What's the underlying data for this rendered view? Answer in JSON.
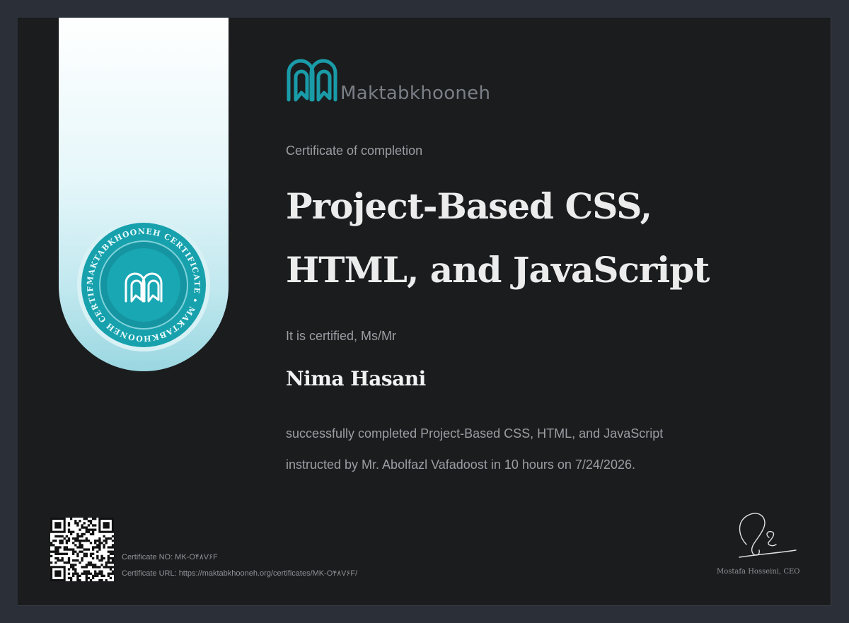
{
  "brand": {
    "name": "Maktabkhooneh",
    "teal": "#1a9ba8",
    "seal_text": "MAKTABKHOONEH CERTIFICATE • MAKTABKHOONEH CERTIFICATE •"
  },
  "certificate": {
    "subtitle": "Certificate of completion",
    "title_line1": "Project-Based CSS,",
    "title_line2": "HTML, and JavaScript",
    "certified_label": "It is certified, Ms/Mr",
    "recipient": "Nima Hasani",
    "desc_line1": "successfully completed Project-Based CSS, HTML, and JavaScript",
    "desc_line2": "instructed by Mr. Abolfazl Vafadoost in 10 hours on 7/24/2026."
  },
  "footer": {
    "cert_no": "Certificate NO: MK-O۴۸V۶F",
    "cert_url": "Certificate URL: https://maktabkhooneh.org/certificates/MK-O۴۸V۶F/",
    "signer": "Mostafa Hosseini, CEO"
  },
  "icons": {
    "logo": "arch-book-logo-icon",
    "qr": "qr-code-icon",
    "seal": "certificate-seal-icon"
  }
}
